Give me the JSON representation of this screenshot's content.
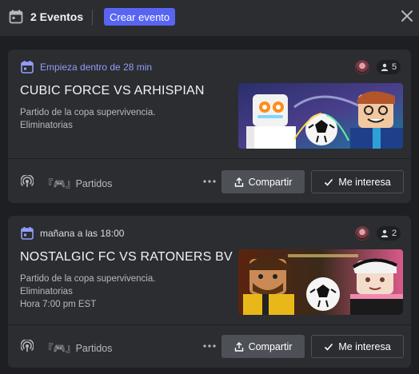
{
  "header": {
    "count_label": "2 Eventos",
    "create_label": "Crear evento"
  },
  "events": [
    {
      "when": "Empieza dentro de 28 min",
      "when_style": "soon",
      "attendees": "5",
      "title": "CUBIC FORCE VS ARHISPIAN",
      "description": [
        "Partido de la copa supervivencia.",
        "Eliminatorias"
      ],
      "channel": "『🎮』Partidos",
      "share_label": "Compartir",
      "interest_label": "Me interesa"
    },
    {
      "when": "mañana a las 18:00",
      "when_style": "later",
      "attendees": "2",
      "title": "NOSTALGIC FC VS RATONERS BV",
      "description": [
        "Partido de la copa supervivencia.",
        "Eliminatorias",
        "Hora 7:00 pm EST"
      ],
      "channel": "『🎮』Partidos",
      "share_label": "Compartir",
      "interest_label": "Me interesa"
    }
  ],
  "colors": {
    "accent": "#5865f2",
    "soon_text": "#949cf7",
    "background": "#1e1f22",
    "card": "#2b2d31"
  }
}
